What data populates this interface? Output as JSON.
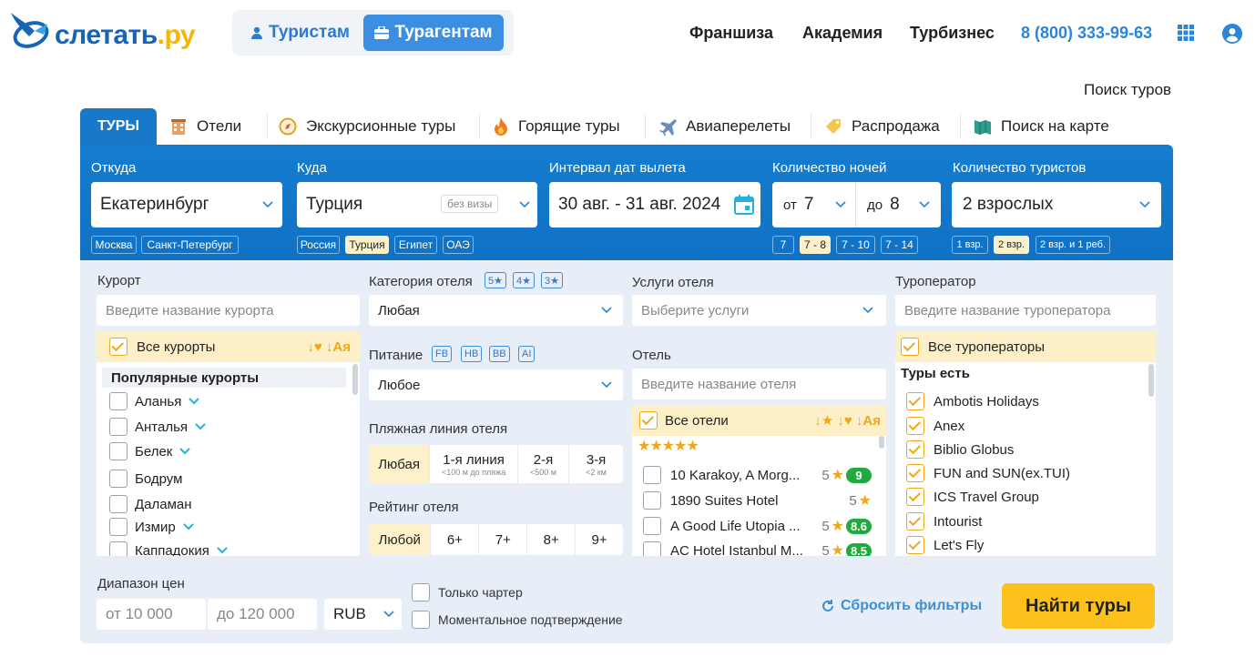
{
  "header": {
    "logo_text_main": "слетать",
    "logo_text_suffix": ".ру",
    "role_tourists": "Туристам",
    "role_agents": "Турагентам",
    "nav": [
      "Франшиза",
      "Академия",
      "Турбизнес"
    ],
    "phone": "8 (800) 333-99-63"
  },
  "page_title": "Поиск туров",
  "tabs": [
    {
      "label": "ТУРЫ",
      "icon": "tours"
    },
    {
      "label": "Отели",
      "icon": "hotel-icon"
    },
    {
      "label": "Экскурсионные туры",
      "icon": "compass-icon"
    },
    {
      "label": "Горящие туры",
      "icon": "fire-icon"
    },
    {
      "label": "Авиаперелеты",
      "icon": "plane-icon"
    },
    {
      "label": "Распродажа",
      "icon": "tag-icon"
    },
    {
      "label": "Поиск на карте",
      "icon": "map-icon"
    }
  ],
  "search": {
    "from": {
      "label": "Откуда",
      "value": "Екатеринбург",
      "chips": [
        "Москва",
        "Санкт-Петербург"
      ]
    },
    "to": {
      "label": "Куда",
      "value": "Турция",
      "badge": "без визы",
      "chips": [
        "Россия",
        "Турция",
        "Египет",
        "ОАЭ"
      ],
      "selected_chip": "Турция"
    },
    "dates": {
      "label": "Интервал дат вылета",
      "value": "30 авг. - 31 авг. 2024"
    },
    "nights": {
      "label": "Количество ночей",
      "from_prefix": "от",
      "from_value": "7",
      "to_prefix": "до",
      "to_value": "8",
      "chips": [
        "7",
        "7 - 8",
        "7 - 10",
        "7 - 14"
      ],
      "selected_chip": "7 - 8"
    },
    "tourists": {
      "label": "Количество туристов",
      "value": "2 взрослых",
      "chips": [
        "1 взр.",
        "2 взр.",
        "2 взр. и 1 реб."
      ],
      "selected_chip": "2 взр."
    }
  },
  "filters": {
    "resort": {
      "label": "Курорт",
      "placeholder": "Введите название курорта",
      "all_label": "Все курорты",
      "sort_icons": "↓♥ ↓Ая",
      "group_label": "Популярные курорты",
      "items": [
        "Аланья",
        "Анталья",
        "Белек",
        "Бодрум",
        "Даламан",
        "Измир",
        "Каппадокия"
      ]
    },
    "category": {
      "label": "Категория отеля",
      "badges": [
        "5★",
        "4★",
        "3★"
      ],
      "value": "Любая"
    },
    "meal": {
      "label": "Питание",
      "badges": [
        "FB",
        "HB",
        "BB",
        "AI"
      ],
      "value": "Любое"
    },
    "beach": {
      "label": "Пляжная линия отеля",
      "options": [
        {
          "main": "Любая",
          "sub": ""
        },
        {
          "main": "1-я линия",
          "sub": "<100 м до пляжа"
        },
        {
          "main": "2-я",
          "sub": "<500 м"
        },
        {
          "main": "3-я",
          "sub": "<2 км"
        }
      ]
    },
    "rating": {
      "label": "Рейтинг отеля",
      "options": [
        "Любой",
        "6+",
        "7+",
        "8+",
        "9+"
      ]
    },
    "services": {
      "label": "Услуги отеля",
      "placeholder": "Выберите услуги"
    },
    "hotel": {
      "label": "Отель",
      "placeholder": "Введите название отеля",
      "all_label": "Все отели",
      "sort_icons": "↓★ ↓♥ ↓Ая",
      "stars_filter": "★★★★★",
      "items": [
        {
          "name": "10 Karakoy, A Morg...",
          "stars": "5",
          "score": "9"
        },
        {
          "name": "1890 Suites Hotel",
          "stars": "5",
          "score": ""
        },
        {
          "name": "A Good Life Utopia ...",
          "stars": "5",
          "score": "8.6"
        },
        {
          "name": "AC Hotel Istanbul M...",
          "stars": "5",
          "score": "8.5"
        }
      ]
    },
    "operator": {
      "label": "Туроператор",
      "placeholder": "Введите название туроператора",
      "all_label": "Все туроператоры",
      "group_label": "Туры есть",
      "items": [
        "Ambotis Holidays",
        "Anex",
        "Biblio Globus",
        "FUN and SUN(ex.TUI)",
        "ICS Travel Group",
        "Intourist",
        "Let's Fly"
      ]
    }
  },
  "price": {
    "label": "Диапазон цен",
    "from": "от 10 000",
    "to": "до 120 000",
    "currency": "RUB"
  },
  "checkboxes": [
    "Только чартер",
    "Моментальное подтверждение"
  ],
  "reset_label": "Сбросить фильтры",
  "find_label": "Найти туры",
  "colors": {
    "brand_blue": "#1878c9",
    "accent_yellow": "#fcc11a",
    "highlight": "#fdf1cc",
    "score_green": "#1fab3d"
  }
}
